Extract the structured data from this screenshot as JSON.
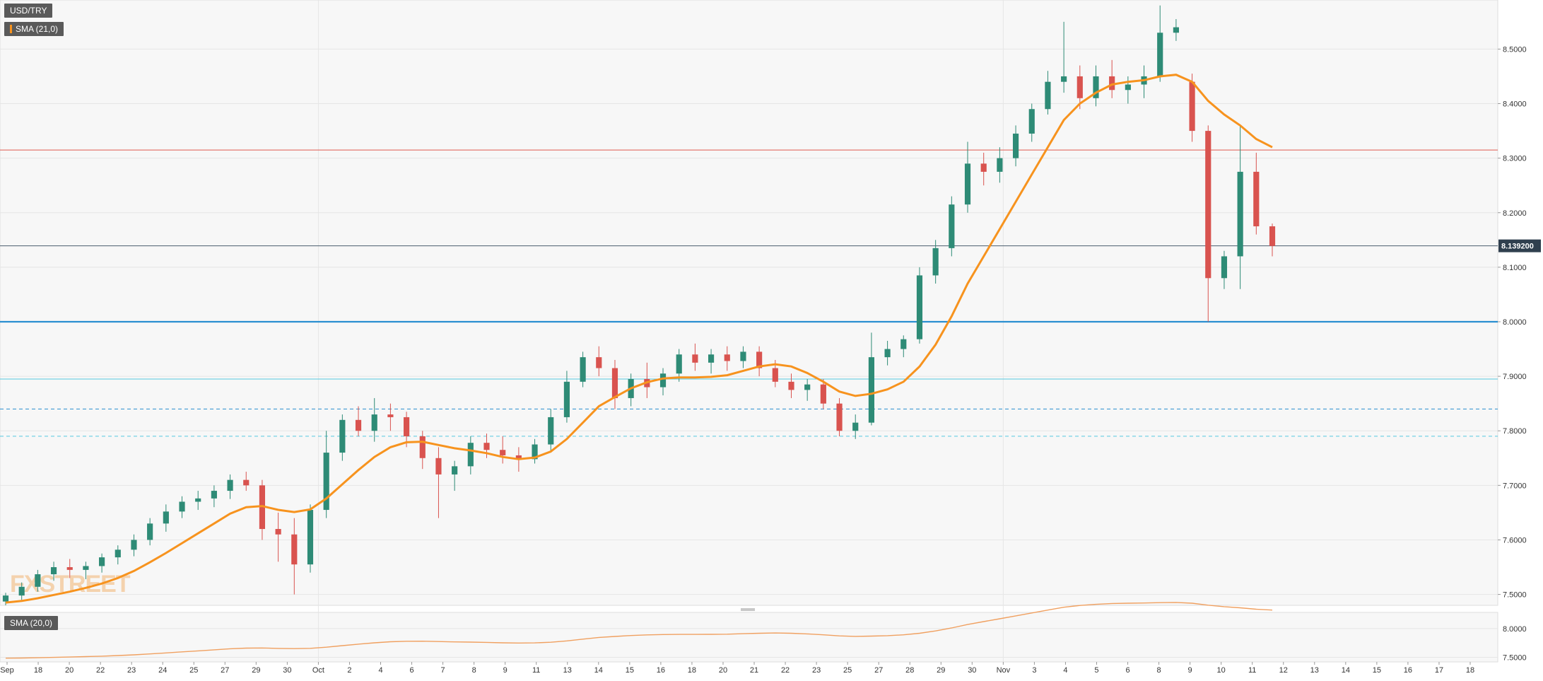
{
  "symbol": "USD/TRY",
  "main_indicator_label": "SMA (21,0)",
  "sub_indicator_label": "SMA (20,0)",
  "watermark": "FXSTREET",
  "last_price_label": "8.139200",
  "colors": {
    "up": "#2e8b76",
    "down": "#d9534f",
    "sma_main": "#f7931e",
    "sma_sub": "#f0a060",
    "resistance_red": "#e05a4f",
    "last_price": "#4a5d6e",
    "support_blue": "#2a8fd0",
    "support_cyan": "#55c8e0"
  },
  "chart_data": [
    {
      "type": "candlestick",
      "title": "USD/TRY",
      "x_tick_labels": [
        "Sep",
        "18",
        "20",
        "22",
        "23",
        "24",
        "25",
        "27",
        "29",
        "30",
        "Oct",
        "2",
        "4",
        "6",
        "7",
        "8",
        "9",
        "11",
        "13",
        "14",
        "15",
        "16",
        "18",
        "20",
        "21",
        "22",
        "23",
        "25",
        "27",
        "28",
        "29",
        "30",
        "Nov",
        "3",
        "4",
        "5",
        "6",
        "8",
        "9",
        "10",
        "11",
        "12",
        "13",
        "14",
        "15",
        "16",
        "17",
        "18"
      ],
      "y_tick_labels": [
        "7.5000",
        "7.6000",
        "7.7000",
        "7.8000",
        "7.9000",
        "8.0000",
        "8.1000",
        "8.2000",
        "8.3000",
        "8.4000",
        "8.5000"
      ],
      "ylim": [
        7.48,
        8.59
      ],
      "horizontal_levels": [
        {
          "value": 8.315,
          "style": "solid",
          "color": "resistance_red"
        },
        {
          "value": 8.1392,
          "style": "solid",
          "color": "last_price"
        },
        {
          "value": 8.0,
          "style": "solid-thick",
          "color": "support_blue"
        },
        {
          "value": 7.895,
          "style": "solid",
          "color": "support_cyan"
        },
        {
          "value": 7.84,
          "style": "dashed",
          "color": "support_blue"
        },
        {
          "value": 7.79,
          "style": "dashed",
          "color": "support_cyan"
        }
      ],
      "candles": [
        [
          7.487,
          7.503,
          7.48,
          7.498
        ],
        [
          7.498,
          7.522,
          7.49,
          7.514
        ],
        [
          7.514,
          7.545,
          7.505,
          7.537
        ],
        [
          7.537,
          7.56,
          7.525,
          7.55
        ],
        [
          7.55,
          7.565,
          7.53,
          7.545
        ],
        [
          7.545,
          7.56,
          7.528,
          7.552
        ],
        [
          7.552,
          7.575,
          7.54,
          7.568
        ],
        [
          7.568,
          7.59,
          7.555,
          7.582
        ],
        [
          7.582,
          7.61,
          7.57,
          7.6
        ],
        [
          7.6,
          7.64,
          7.59,
          7.63
        ],
        [
          7.63,
          7.665,
          7.615,
          7.652
        ],
        [
          7.652,
          7.68,
          7.64,
          7.67
        ],
        [
          7.67,
          7.69,
          7.655,
          7.676
        ],
        [
          7.676,
          7.7,
          7.66,
          7.69
        ],
        [
          7.69,
          7.72,
          7.675,
          7.71
        ],
        [
          7.71,
          7.725,
          7.69,
          7.7
        ],
        [
          7.7,
          7.71,
          7.6,
          7.62
        ],
        [
          7.62,
          7.65,
          7.56,
          7.61
        ],
        [
          7.61,
          7.64,
          7.5,
          7.555
        ],
        [
          7.555,
          7.665,
          7.54,
          7.655
        ],
        [
          7.655,
          7.8,
          7.64,
          7.76
        ],
        [
          7.76,
          7.83,
          7.745,
          7.82
        ],
        [
          7.82,
          7.845,
          7.79,
          7.8
        ],
        [
          7.8,
          7.86,
          7.78,
          7.83
        ],
        [
          7.83,
          7.85,
          7.8,
          7.825
        ],
        [
          7.825,
          7.835,
          7.77,
          7.79
        ],
        [
          7.79,
          7.8,
          7.73,
          7.75
        ],
        [
          7.75,
          7.77,
          7.64,
          7.72
        ],
        [
          7.72,
          7.745,
          7.69,
          7.735
        ],
        [
          7.735,
          7.79,
          7.72,
          7.778
        ],
        [
          7.778,
          7.795,
          7.75,
          7.765
        ],
        [
          7.765,
          7.79,
          7.74,
          7.755
        ],
        [
          7.755,
          7.77,
          7.725,
          7.748
        ],
        [
          7.748,
          7.785,
          7.74,
          7.775
        ],
        [
          7.775,
          7.84,
          7.76,
          7.825
        ],
        [
          7.825,
          7.91,
          7.815,
          7.89
        ],
        [
          7.89,
          7.945,
          7.88,
          7.935
        ],
        [
          7.935,
          7.955,
          7.9,
          7.915
        ],
        [
          7.915,
          7.93,
          7.84,
          7.86
        ],
        [
          7.86,
          7.905,
          7.845,
          7.895
        ],
        [
          7.895,
          7.925,
          7.86,
          7.88
        ],
        [
          7.88,
          7.915,
          7.865,
          7.905
        ],
        [
          7.905,
          7.95,
          7.89,
          7.94
        ],
        [
          7.94,
          7.96,
          7.91,
          7.925
        ],
        [
          7.925,
          7.95,
          7.905,
          7.94
        ],
        [
          7.94,
          7.955,
          7.91,
          7.928
        ],
        [
          7.928,
          7.955,
          7.915,
          7.945
        ],
        [
          7.945,
          7.955,
          7.9,
          7.915
        ],
        [
          7.915,
          7.93,
          7.88,
          7.89
        ],
        [
          7.89,
          7.905,
          7.86,
          7.875
        ],
        [
          7.875,
          7.895,
          7.855,
          7.885
        ],
        [
          7.885,
          7.895,
          7.84,
          7.85
        ],
        [
          7.85,
          7.86,
          7.79,
          7.8
        ],
        [
          7.8,
          7.83,
          7.785,
          7.815
        ],
        [
          7.815,
          7.98,
          7.81,
          7.935
        ],
        [
          7.935,
          7.965,
          7.92,
          7.95
        ],
        [
          7.95,
          7.975,
          7.935,
          7.968
        ],
        [
          7.968,
          8.1,
          7.96,
          8.085
        ],
        [
          8.085,
          8.15,
          8.07,
          8.135
        ],
        [
          8.135,
          8.23,
          8.12,
          8.215
        ],
        [
          8.215,
          8.33,
          8.2,
          8.29
        ],
        [
          8.29,
          8.31,
          8.25,
          8.275
        ],
        [
          8.275,
          8.32,
          8.255,
          8.3
        ],
        [
          8.3,
          8.36,
          8.285,
          8.345
        ],
        [
          8.345,
          8.4,
          8.33,
          8.39
        ],
        [
          8.39,
          8.46,
          8.38,
          8.44
        ],
        [
          8.44,
          8.55,
          8.42,
          8.45
        ],
        [
          8.45,
          8.47,
          8.39,
          8.41
        ],
        [
          8.41,
          8.47,
          8.395,
          8.45
        ],
        [
          8.45,
          8.48,
          8.41,
          8.425
        ],
        [
          8.425,
          8.45,
          8.4,
          8.435
        ],
        [
          8.435,
          8.47,
          8.41,
          8.45
        ],
        [
          8.45,
          8.58,
          8.44,
          8.53
        ],
        [
          8.53,
          8.555,
          8.515,
          8.54
        ],
        [
          8.44,
          8.455,
          8.33,
          8.35
        ],
        [
          8.35,
          8.36,
          8.0,
          8.08
        ],
        [
          8.08,
          8.13,
          8.06,
          8.12
        ],
        [
          8.12,
          8.36,
          8.06,
          8.275
        ],
        [
          8.275,
          8.31,
          8.16,
          8.175
        ],
        [
          8.175,
          8.18,
          8.12,
          8.139
        ]
      ],
      "sma_main_values": [
        7.485,
        7.488,
        7.493,
        7.499,
        7.505,
        7.512,
        7.52,
        7.53,
        7.543,
        7.559,
        7.576,
        7.594,
        7.612,
        7.63,
        7.648,
        7.66,
        7.662,
        7.655,
        7.651,
        7.656,
        7.676,
        7.702,
        7.728,
        7.752,
        7.77,
        7.779,
        7.78,
        7.774,
        7.768,
        7.764,
        7.759,
        7.752,
        7.748,
        7.751,
        7.762,
        7.785,
        7.815,
        7.845,
        7.862,
        7.878,
        7.889,
        7.896,
        7.898,
        7.898,
        7.899,
        7.902,
        7.91,
        7.918,
        7.922,
        7.918,
        7.906,
        7.89,
        7.872,
        7.864,
        7.868,
        7.876,
        7.89,
        7.918,
        7.958,
        8.01,
        8.07,
        8.12,
        8.17,
        8.22,
        8.27,
        8.32,
        8.37,
        8.4,
        8.42,
        8.435,
        8.44,
        8.443,
        8.45,
        8.453,
        8.44,
        8.405,
        8.38,
        8.36,
        8.335,
        8.32
      ],
      "sub_chart": {
        "title": "SMA (20,0)",
        "y_tick_labels": [
          "7.5000",
          "8.0000"
        ],
        "ylim": [
          7.42,
          8.28
        ]
      }
    }
  ]
}
